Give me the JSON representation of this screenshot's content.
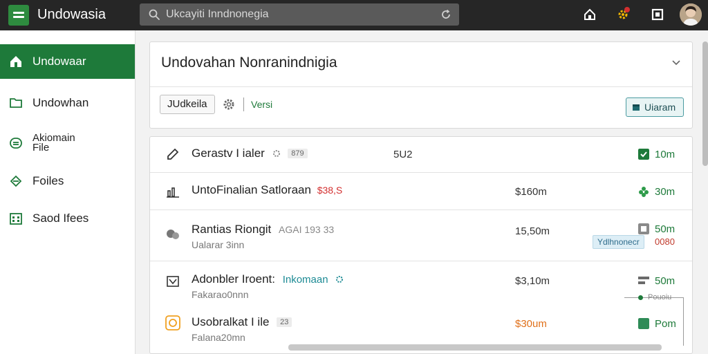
{
  "app": {
    "title": "Undowasia"
  },
  "search": {
    "value": "Ukcayiti Inndnonegia",
    "placeholder": ""
  },
  "sidebar": {
    "items": [
      {
        "label": "Undowaar",
        "icon": "home-icon",
        "active": true
      },
      {
        "label": "Undowhan",
        "icon": "folder-icon",
        "active": false
      },
      {
        "label": "Akiomain File",
        "icon": "file-stack-icon",
        "active": false
      },
      {
        "label": "Foiles",
        "icon": "share-icon",
        "active": false
      },
      {
        "label": "Saod Ifees",
        "icon": "calendar-icon",
        "active": false
      }
    ]
  },
  "header": {
    "title": "Undovahan Nonranindnigia",
    "filter_label": "JUdkeila",
    "version_link": "Versi",
    "primary_button": "Uiaram"
  },
  "files": [
    {
      "name": "Gerastv I ialer",
      "pill": "879",
      "size": "5U2",
      "extra": "",
      "time": "10m",
      "icon": "edit-icon",
      "tag_color": "#1e7a3a"
    },
    {
      "name": "UntoFinalian Satloraan",
      "accent": "$38,S",
      "size": "$160m",
      "extra": "",
      "time": "30m",
      "icon": "chart-icon",
      "tag_color": "#2e9b4a"
    },
    {
      "name": "Rantias Riongit",
      "trailing": "AGAI 193 33",
      "sub": "Ualarar 3inn",
      "size": "15,50m",
      "time": "50m",
      "badge": "Ydlhnonecr",
      "badge_num": "0080",
      "icon": "chat-bubbles-icon",
      "tag_color": "#8a8a8a"
    },
    {
      "name": "Adonbler Iroent:",
      "accent_teal": "Inkomaan",
      "sub": "Fakarao0nnn",
      "size": "$3,10m",
      "time": "50m",
      "icon": "image-icon",
      "tag_color": "#6a6a6a"
    },
    {
      "name": "Usobralkat I ile",
      "pill": "23",
      "sub": "Falana20mn",
      "size": "$30um",
      "time": "Pom",
      "icon": "circle-badge-icon",
      "tag_color": "#2e8b57",
      "size_color": "#e0701a"
    }
  ],
  "colors": {
    "accent": "#1e7a3a",
    "topbar": "#262626",
    "active_nav": "#1e7a3a"
  },
  "connector_label": "Pouoiu"
}
